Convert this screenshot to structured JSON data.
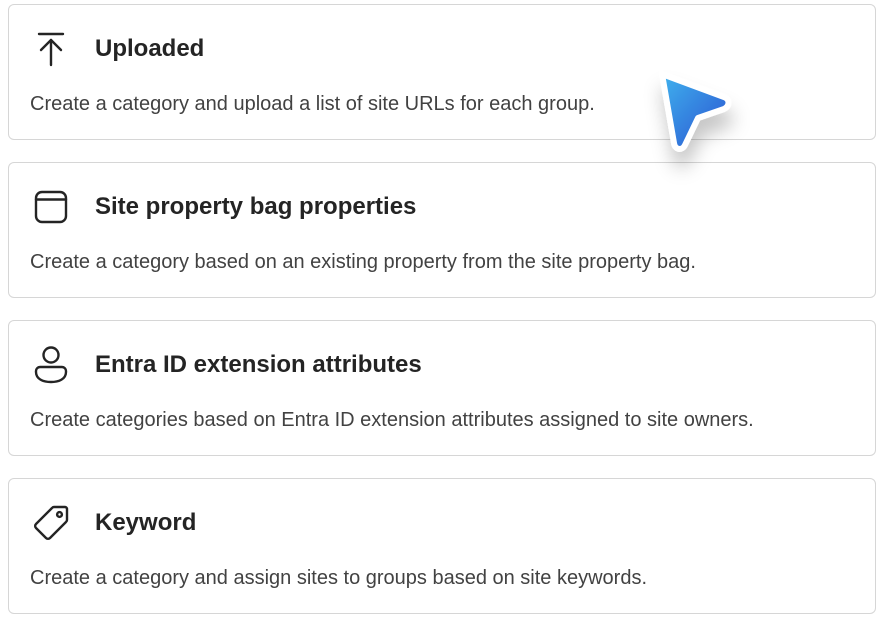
{
  "options": [
    {
      "icon": "upload-icon",
      "title": "Uploaded",
      "description": "Create a category and upload a list of site URLs for each group."
    },
    {
      "icon": "window-icon",
      "title": "Site property bag properties",
      "description": "Create a category based on an existing property from the site property bag."
    },
    {
      "icon": "person-icon",
      "title": "Entra ID extension attributes",
      "description": "Create categories based on Entra ID extension attributes assigned to site owners."
    },
    {
      "icon": "tag-icon",
      "title": "Keyword",
      "description": "Create a category and assign sites to groups based on site keywords."
    }
  ],
  "colors": {
    "text_primary": "#242424",
    "text_secondary": "#424242",
    "card_border": "#d6d6d6",
    "pointer_light": "#3aa0e8",
    "pointer_dark": "#2f62d6"
  }
}
